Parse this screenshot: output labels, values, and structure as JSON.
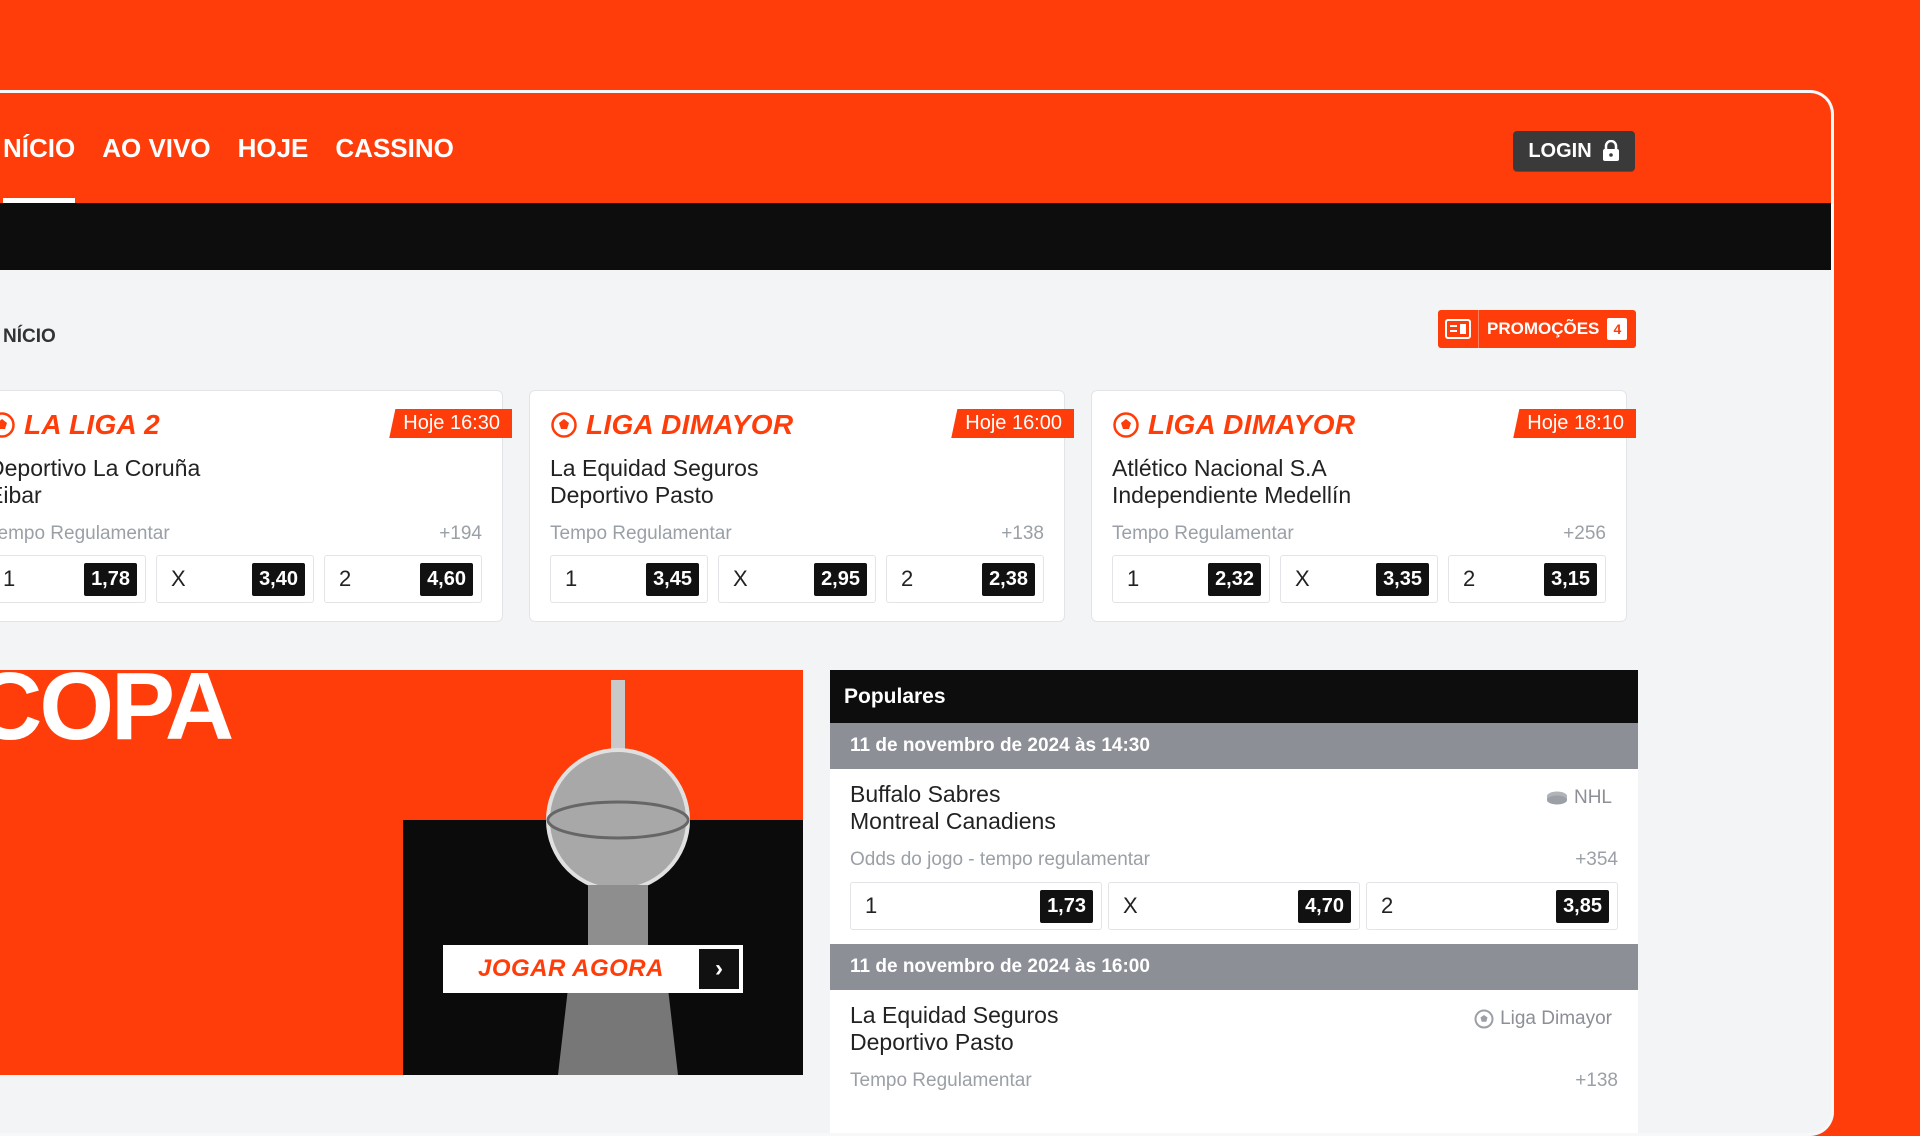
{
  "nav": {
    "items": [
      "NÍCIO",
      "AO VIVO",
      "HOJE",
      "CASSINO"
    ],
    "login_label": "LOGIN"
  },
  "breadcrumb": "NÍCIO",
  "promotions": {
    "label": "PROMOÇÕES",
    "count": "4"
  },
  "cards": [
    {
      "league": "LA LIGA 2",
      "time": "Hoje 16:30",
      "home": "Deportivo La Coruña",
      "away": "Eibar",
      "market": "Tempo Regulamentar",
      "more": "+194",
      "odds": [
        {
          "label": "1",
          "value": "1,78"
        },
        {
          "label": "X",
          "value": "3,40"
        },
        {
          "label": "2",
          "value": "4,60"
        }
      ]
    },
    {
      "league": "LIGA DIMAYOR",
      "time": "Hoje 16:00",
      "home": "La Equidad Seguros",
      "away": "Deportivo Pasto",
      "market": "Tempo Regulamentar",
      "more": "+138",
      "odds": [
        {
          "label": "1",
          "value": "3,45"
        },
        {
          "label": "X",
          "value": "2,95"
        },
        {
          "label": "2",
          "value": "2,38"
        }
      ]
    },
    {
      "league": "LIGA DIMAYOR",
      "time": "Hoje 18:10",
      "home": "Atlético Nacional S.A",
      "away": "Independiente Medellín",
      "market": "Tempo Regulamentar",
      "more": "+256",
      "odds": [
        {
          "label": "1",
          "value": "2,32"
        },
        {
          "label": "X",
          "value": "3,35"
        },
        {
          "label": "2",
          "value": "3,15"
        }
      ]
    }
  ],
  "banner": {
    "title": "COPA",
    "cta": "JOGAR AGORA"
  },
  "popular": {
    "title": "Populares",
    "groups": [
      {
        "date": "11 de novembro de 2024 às 14:30",
        "home": "Buffalo Sabres",
        "away": "Montreal Canadiens",
        "league": "NHL",
        "market": "Odds do jogo - tempo regulamentar",
        "more": "+354",
        "odds": [
          {
            "label": "1",
            "value": "1,73"
          },
          {
            "label": "X",
            "value": "4,70"
          },
          {
            "label": "2",
            "value": "3,85"
          }
        ]
      },
      {
        "date": "11 de novembro de 2024 às 16:00",
        "home": "La Equidad Seguros",
        "away": "Deportivo Pasto",
        "league": "Liga Dimayor",
        "market": "Tempo Regulamentar",
        "more": "+138"
      }
    ]
  },
  "colors": {
    "accent": "#ff3d0a",
    "dark": "#0d0d0d",
    "bg": "#f3f4f6"
  }
}
